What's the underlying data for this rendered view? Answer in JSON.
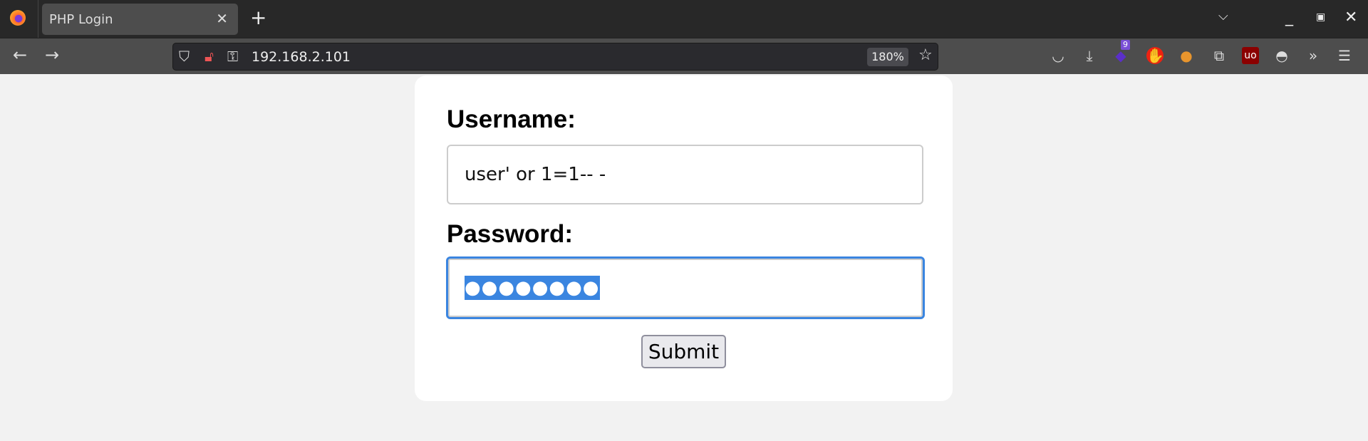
{
  "browser": {
    "tab_title": "PHP Login",
    "url": "192.168.2.101",
    "zoom": "180%",
    "extension_badge": "9"
  },
  "form": {
    "username_label": "Username:",
    "username_value": "user' or 1=1-- -",
    "password_label": "Password:",
    "password_mask": "●●●●●●●●",
    "submit_label": "Submit"
  },
  "colors": {
    "focus": "#3a85e0",
    "card": "#ffffff",
    "page": "#f2f2f2"
  }
}
